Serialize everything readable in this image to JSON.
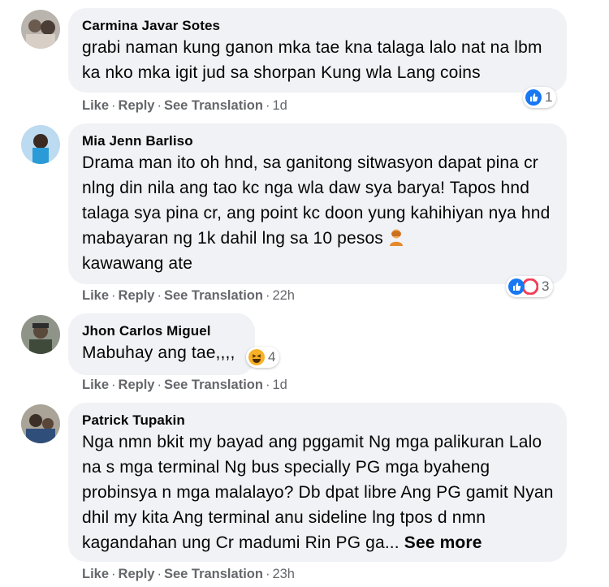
{
  "actions": {
    "like": "Like",
    "reply": "Reply",
    "translate": "See Translation",
    "sep": "·"
  },
  "comments": [
    {
      "author": "Carmina Javar Sotes",
      "text": "grabi naman kung ganon mka tae kna talaga lalo nat na lbm ka nko mka igit jud sa shorpan Kung wla Lang coins",
      "time": "1d",
      "reactions": [
        "like"
      ],
      "reaction_count": "1"
    },
    {
      "author": "Mia Jenn Barliso",
      "text": "Drama man ito oh hnd, sa ganitong sitwasyon dapat pina cr nlng din nila ang tao kc nga wla daw sya barya! Tapos hnd talaga sya pina cr, ang point kc doon yung kahihiyan nya hnd mabayaran ng 1k dahil lng sa 10 pesos",
      "text_end": "kawawang ate",
      "time": "22h",
      "reactions": [
        "like",
        "care"
      ],
      "reaction_count": "3"
    },
    {
      "author": "Jhon Carlos Miguel",
      "text": "Mabuhay ang tae,,,,",
      "time": "1d",
      "reactions": [
        "haha"
      ],
      "reaction_count": "4"
    },
    {
      "author": "Patrick Tupakin",
      "text": "Nga nmn bkit my bayad ang pggamit Ng mga palikuran Lalo na s mga terminal Ng bus specially PG mga byaheng probinsya n mga malalayo? Db dpat libre Ang PG gamit Nyan dhil my kita Ang terminal anu sideline lng tpos d nmn kagandahan ung Cr madumi Rin PG ga...",
      "see_more": "See more",
      "time": "23h"
    }
  ],
  "colors": {
    "bubble": "#f0f2f5",
    "meta": "#65676b",
    "like_blue": "#1877f2",
    "haha_yellow": "#f7b125"
  }
}
